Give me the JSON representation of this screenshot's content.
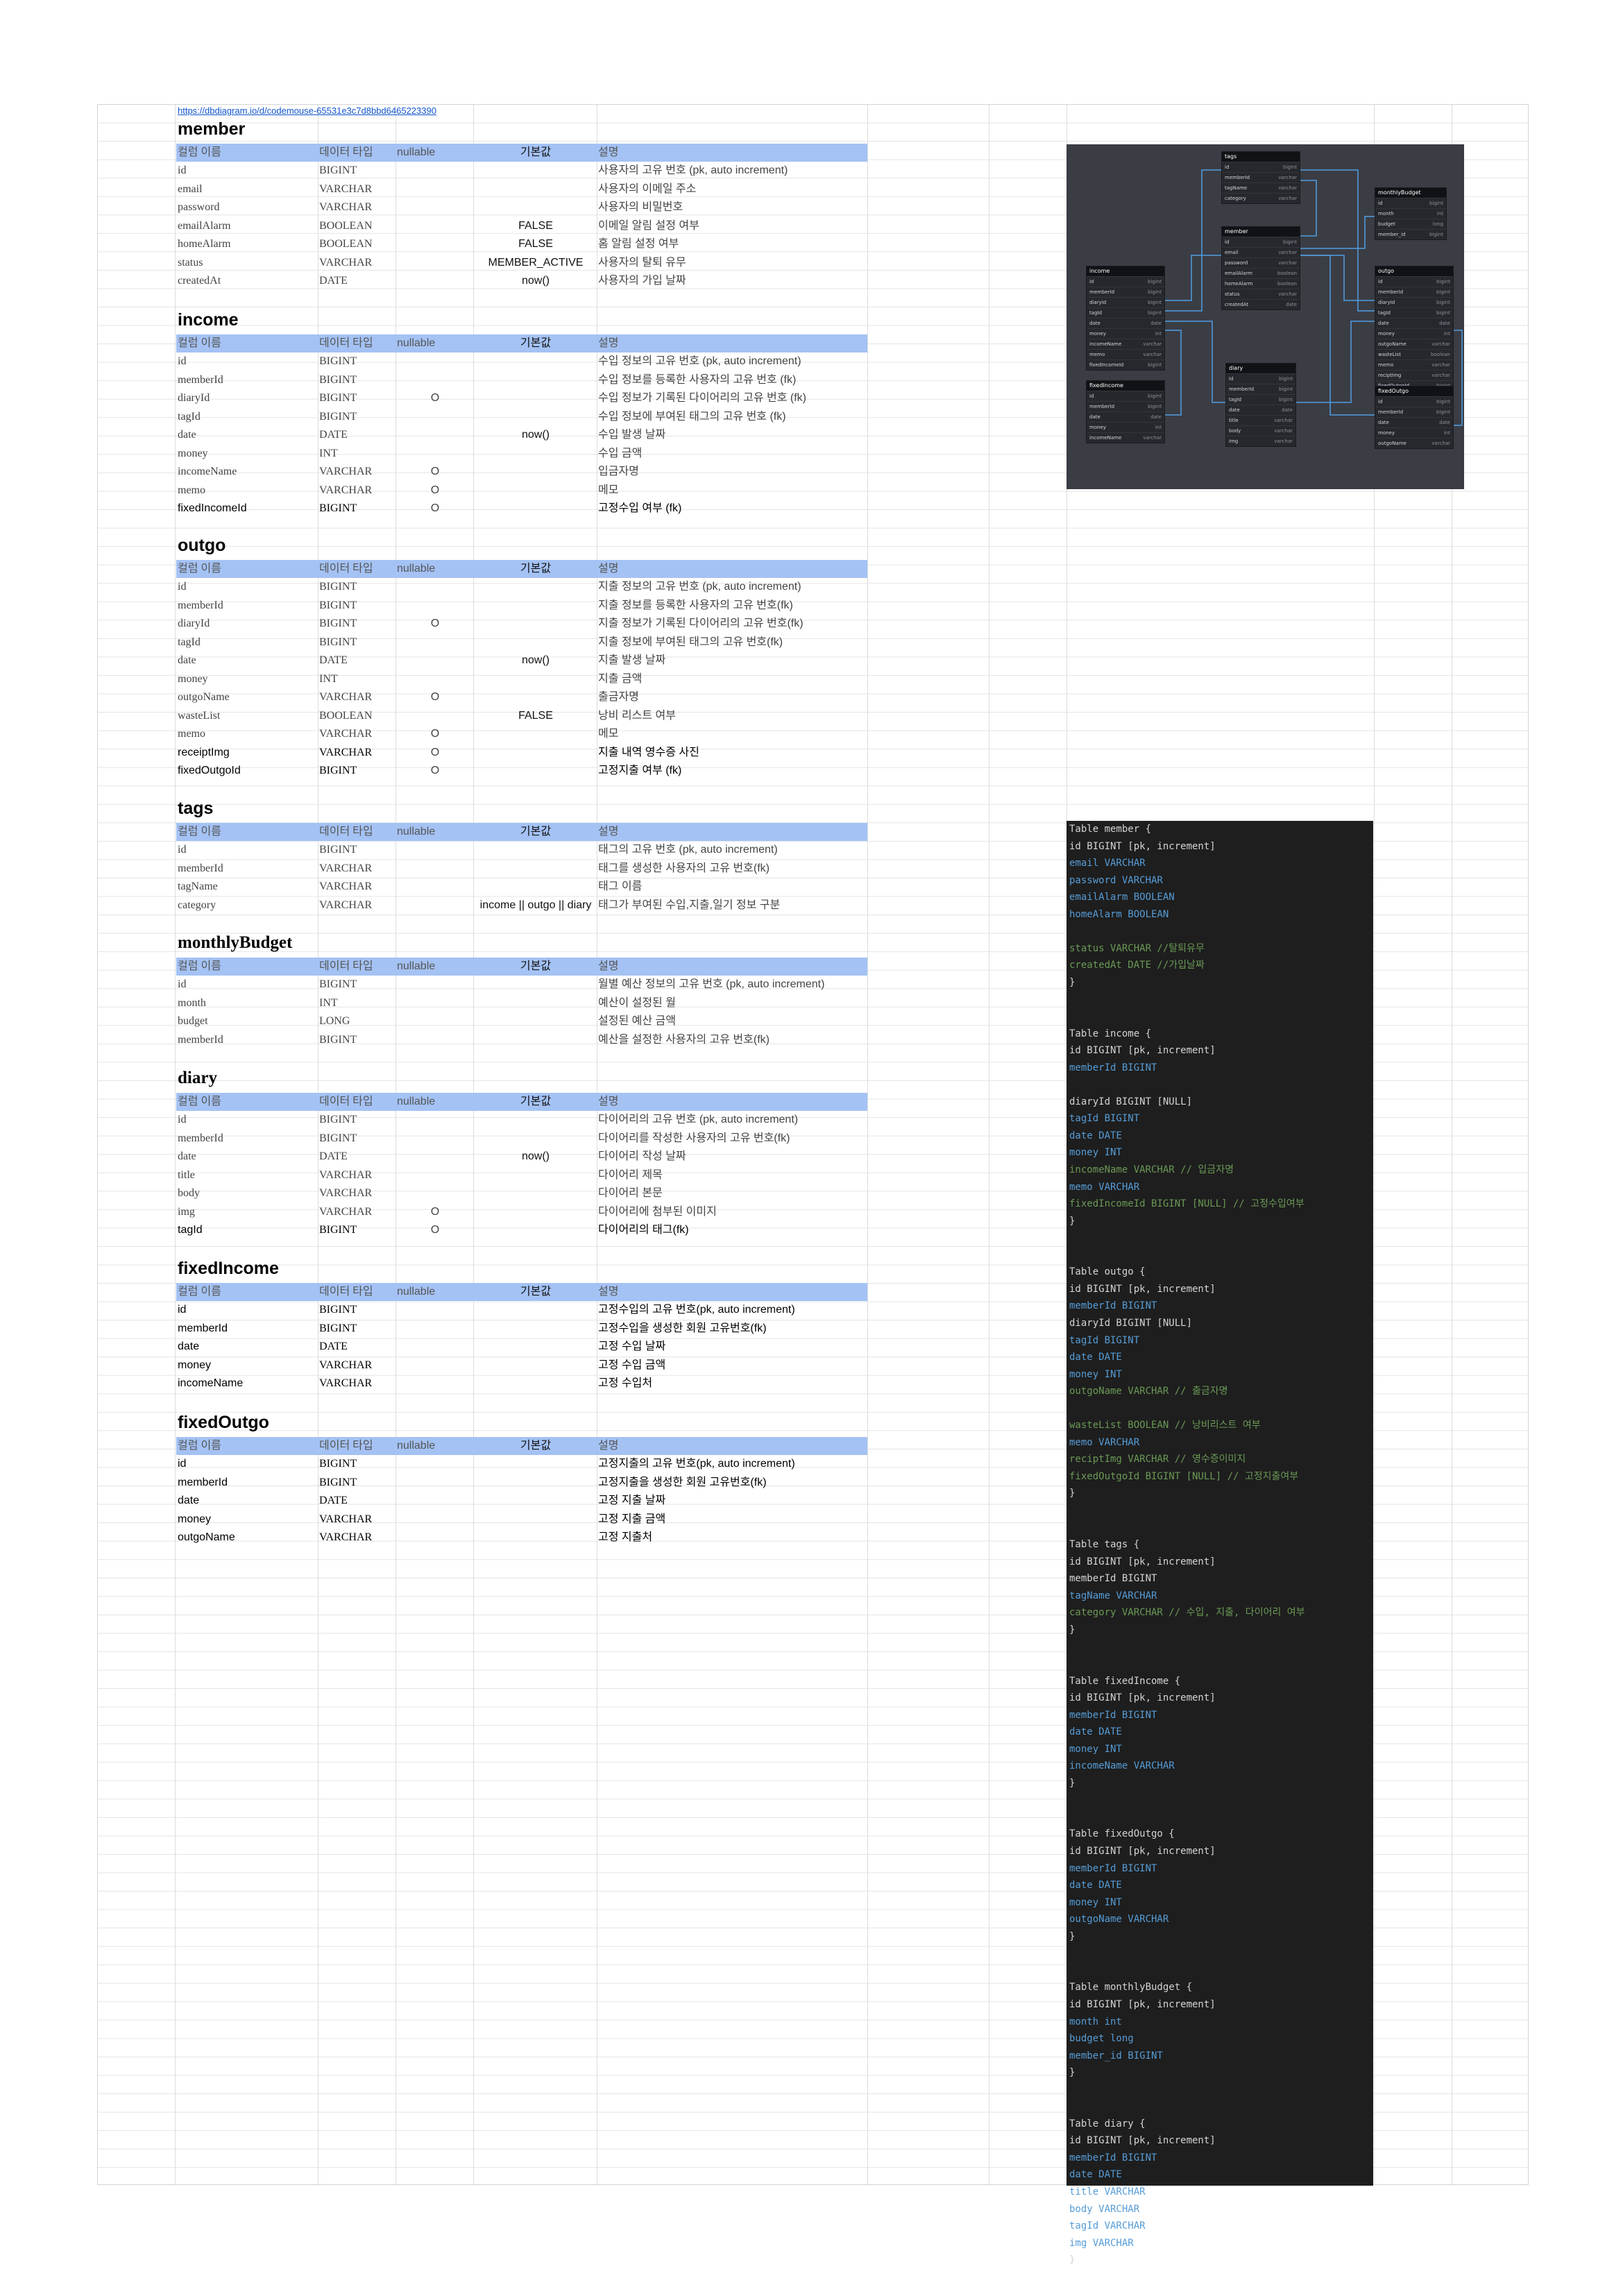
{
  "url": "https://dbdiagram.io/d/codemouse-65531e3c7d8bbd6465223390",
  "header_labels": [
    "컬럼 이름",
    "데이터 타입",
    "nullable",
    "기본값",
    "설명"
  ],
  "sections": [
    {
      "title": "member",
      "rows": [
        {
          "name": "id",
          "type": "BIGINT",
          "nullable": "",
          "default": "",
          "desc": "사용자의 고유 번호 (pk, auto increment)"
        },
        {
          "name": "email",
          "type": "VARCHAR",
          "nullable": "",
          "default": "",
          "desc": "사용자의 이메일 주소"
        },
        {
          "name": "password",
          "type": "VARCHAR",
          "nullable": "",
          "default": "",
          "desc": "사용자의 비밀번호"
        },
        {
          "name": "emailAlarm",
          "type": "BOOLEAN",
          "nullable": "",
          "default": "FALSE",
          "desc": "이메일 알림 설정 여부"
        },
        {
          "name": "homeAlarm",
          "type": "BOOLEAN",
          "nullable": "",
          "default": "FALSE",
          "desc": "홈 알림 설정 여부"
        },
        {
          "name": "status",
          "type": "VARCHAR",
          "nullable": "",
          "default": "MEMBER_ACTIVE",
          "desc": "사용자의 탈퇴 유무"
        },
        {
          "name": "createdAt",
          "type": "DATE",
          "nullable": "",
          "default": "now()",
          "desc": "사용자의 가입 날짜"
        }
      ]
    },
    {
      "title": "income",
      "rows": [
        {
          "name": "id",
          "type": "BIGINT",
          "nullable": "",
          "default": "",
          "desc": "수입 정보의 고유 번호 (pk, auto increment)"
        },
        {
          "name": "memberId",
          "type": "BIGINT",
          "nullable": "",
          "default": "",
          "desc": "수입 정보를 등록한 사용자의 고유 번호 (fk)"
        },
        {
          "name": "diaryId",
          "type": "BIGINT",
          "nullable": "O",
          "default": "",
          "desc": "수입 정보가 기록된 다이어리의 고유 번호 (fk)"
        },
        {
          "name": "tagId",
          "type": "BIGINT",
          "nullable": "",
          "default": "",
          "desc": "수입 정보에 부여된 태그의 고유 번호 (fk)"
        },
        {
          "name": "date",
          "type": "DATE",
          "nullable": "",
          "default": "now()",
          "desc": "수입 발생 날짜"
        },
        {
          "name": "money",
          "type": "INT",
          "nullable": "",
          "default": "",
          "desc": "수입 금액"
        },
        {
          "name": "incomeName",
          "type": "VARCHAR",
          "nullable": "O",
          "default": "",
          "desc": "입금자명"
        },
        {
          "name": "memo",
          "type": "VARCHAR",
          "nullable": "O",
          "default": "",
          "desc": "메모"
        },
        {
          "name": "fixedIncomeId",
          "type": "BIGINT",
          "nullable": "O",
          "default": "",
          "desc": "고정수입 여부 (fk)",
          "dark": true
        }
      ]
    },
    {
      "title": "outgo",
      "rows": [
        {
          "name": "id",
          "type": "BIGINT",
          "nullable": "",
          "default": "",
          "desc": "지출 정보의 고유 번호 (pk, auto increment)"
        },
        {
          "name": "memberId",
          "type": "BIGINT",
          "nullable": "",
          "default": "",
          "desc": "지출 정보를 등록한 사용자의 고유 번호(fk)"
        },
        {
          "name": "diaryId",
          "type": "BIGINT",
          "nullable": "O",
          "default": "",
          "desc": "지출 정보가 기록된 다이어리의 고유 번호(fk)"
        },
        {
          "name": "tagId",
          "type": "BIGINT",
          "nullable": "",
          "default": "",
          "desc": "지출 정보에 부여된 태그의 고유 번호(fk)"
        },
        {
          "name": "date",
          "type": "DATE",
          "nullable": "",
          "default": "now()",
          "desc": "지출 발생 날짜"
        },
        {
          "name": "money",
          "type": "INT",
          "nullable": "",
          "default": "",
          "desc": "지출 금액"
        },
        {
          "name": "outgoName",
          "type": "VARCHAR",
          "nullable": "O",
          "default": "",
          "desc": "출금자명"
        },
        {
          "name": "wasteList",
          "type": "BOOLEAN",
          "nullable": "",
          "default": "FALSE",
          "desc": "낭비 리스트 여부"
        },
        {
          "name": "memo",
          "type": "VARCHAR",
          "nullable": "O",
          "default": "",
          "desc": "메모"
        },
        {
          "name": "receiptImg",
          "type": "VARCHAR",
          "nullable": "O",
          "default": "",
          "desc": "지출 내역 영수증 사진",
          "dark": true
        },
        {
          "name": "fixedOutgoId",
          "type": "BIGINT",
          "nullable": "O",
          "default": "",
          "desc": "고정지출 여부 (fk)",
          "dark": true
        }
      ]
    },
    {
      "title": "tags",
      "rows": [
        {
          "name": "id",
          "type": "BIGINT",
          "nullable": "",
          "default": "",
          "desc": "태그의 고유 번호 (pk, auto increment)"
        },
        {
          "name": "memberId",
          "type": "VARCHAR",
          "nullable": "",
          "default": "",
          "desc": "태그를 생성한 사용자의 고유 번호(fk)"
        },
        {
          "name": "tagName",
          "type": "VARCHAR",
          "nullable": "",
          "default": "",
          "desc": "태그 이름"
        },
        {
          "name": "category",
          "type": "VARCHAR",
          "nullable": "",
          "default": "income || outgo || diary",
          "desc": "태그가 부여된 수입,지출,일기 정보 구분"
        }
      ]
    },
    {
      "title": "monthlyBudget",
      "serif": true,
      "rows": [
        {
          "name": "id",
          "type": "BIGINT",
          "nullable": "",
          "default": "",
          "desc": "월별 예산 정보의 고유 번호 (pk, auto increment)"
        },
        {
          "name": "month",
          "type": "INT",
          "nullable": "",
          "default": "",
          "desc": "예산이 설정된 월"
        },
        {
          "name": "budget",
          "type": "LONG",
          "nullable": "",
          "default": "",
          "desc": "설정된 예산 금액"
        },
        {
          "name": "memberId",
          "type": "BIGINT",
          "nullable": "",
          "default": "",
          "desc": "예산을 설정한 사용자의 고유 번호(fk)"
        }
      ]
    },
    {
      "title": "diary",
      "serif": true,
      "rows": [
        {
          "name": "id",
          "type": "BIGINT",
          "nullable": "",
          "default": "",
          "desc": "다이어리의 고유 번호 (pk, auto increment)"
        },
        {
          "name": "memberId",
          "type": "BIGINT",
          "nullable": "",
          "default": "",
          "desc": "다이어리를 작성한 사용자의 고유 번호(fk)"
        },
        {
          "name": "date",
          "type": "DATE",
          "nullable": "",
          "default": "now()",
          "desc": "다이어리 작성 날짜"
        },
        {
          "name": "title",
          "type": "VARCHAR",
          "nullable": "",
          "default": "",
          "desc": "다이어리 제목"
        },
        {
          "name": "body",
          "type": "VARCHAR",
          "nullable": "",
          "default": "",
          "desc": "다이어리 본문"
        },
        {
          "name": "img",
          "type": "VARCHAR",
          "nullable": "O",
          "default": "",
          "desc": "다이어리에 첨부된 이미지"
        },
        {
          "name": "tagId",
          "type": "BIGINT",
          "nullable": "O",
          "default": "",
          "desc": "다이어리의 태그(fk)",
          "dark": true
        }
      ]
    },
    {
      "title": "fixedIncome",
      "rows": [
        {
          "name": "id",
          "type": "BIGINT",
          "nullable": "",
          "default": "",
          "desc": "고정수입의 고유 번호(pk, auto increment)",
          "dark": true
        },
        {
          "name": "memberId",
          "type": "BIGINT",
          "nullable": "",
          "default": "",
          "desc": "고정수입을 생성한 회원 고유번호(fk)",
          "dark": true
        },
        {
          "name": "date",
          "type": "DATE",
          "nullable": "",
          "default": "",
          "desc": "고정 수입 날짜",
          "dark": true
        },
        {
          "name": "money",
          "type": "VARCHAR",
          "nullable": "",
          "default": "",
          "desc": "고정 수입 금액",
          "dark": true
        },
        {
          "name": "incomeName",
          "type": "VARCHAR",
          "nullable": "",
          "default": "",
          "desc": "고정 수입처",
          "dark": true
        }
      ]
    },
    {
      "title": "fixedOutgo",
      "rows": [
        {
          "name": "id",
          "type": "BIGINT",
          "nullable": "",
          "default": "",
          "desc": "고정지출의 고유 번호(pk, auto increment)",
          "dark": true
        },
        {
          "name": "memberId",
          "type": "BIGINT",
          "nullable": "",
          "default": "",
          "desc": "고정지출을 생성한 회원 고유번호(fk)",
          "dark": true
        },
        {
          "name": "date",
          "type": "DATE",
          "nullable": "",
          "default": "",
          "desc": "고정 지출 날짜",
          "dark": true
        },
        {
          "name": "money",
          "type": "VARCHAR",
          "nullable": "",
          "default": "",
          "desc": "고정 지출 금액",
          "dark": true
        },
        {
          "name": "outgoName",
          "type": "VARCHAR",
          "nullable": "",
          "default": "",
          "desc": "고정 지출처",
          "dark": true
        }
      ]
    }
  ],
  "er_diagram": {
    "tables": [
      {
        "name": "tags",
        "fields": [
          [
            "id",
            "bigint"
          ],
          [
            "memberId",
            "varchar"
          ],
          [
            "tagName",
            "varchar"
          ],
          [
            "category",
            "varchar"
          ]
        ]
      },
      {
        "name": "monthlyBudget",
        "fields": [
          [
            "id",
            "bigint"
          ],
          [
            "month",
            "int"
          ],
          [
            "budget",
            "long"
          ],
          [
            "member_id",
            "bigint"
          ]
        ]
      },
      {
        "name": "member",
        "fields": [
          [
            "id",
            "bigint"
          ],
          [
            "email",
            "varchar"
          ],
          [
            "password",
            "varchar"
          ],
          [
            "emailAlarm",
            "boolean"
          ],
          [
            "homeAlarm",
            "boolean"
          ],
          [
            "status",
            "varchar"
          ],
          [
            "createdAt",
            "date"
          ]
        ]
      },
      {
        "name": "income",
        "fields": [
          [
            "id",
            "bigint"
          ],
          [
            "memberId",
            "bigint"
          ],
          [
            "diaryId",
            "bigint"
          ],
          [
            "tagId",
            "bigint"
          ],
          [
            "date",
            "date"
          ],
          [
            "money",
            "int"
          ],
          [
            "incomeName",
            "varchar"
          ],
          [
            "memo",
            "varchar"
          ],
          [
            "fixedIncomeId",
            "bigint"
          ]
        ]
      },
      {
        "name": "outgo",
        "fields": [
          [
            "id",
            "bigint"
          ],
          [
            "memberId",
            "bigint"
          ],
          [
            "diaryId",
            "bigint"
          ],
          [
            "tagId",
            "bigint"
          ],
          [
            "date",
            "date"
          ],
          [
            "money",
            "int"
          ],
          [
            "outgoName",
            "varchar"
          ],
          [
            "wasteList",
            "boolean"
          ],
          [
            "memo",
            "varchar"
          ],
          [
            "reciptImg",
            "varchar"
          ],
          [
            "fixedOutgoId",
            "bigint"
          ]
        ]
      },
      {
        "name": "diary",
        "fields": [
          [
            "id",
            "bigint"
          ],
          [
            "memberId",
            "bigint"
          ],
          [
            "tagId",
            "bigint"
          ],
          [
            "date",
            "date"
          ],
          [
            "title",
            "varchar"
          ],
          [
            "body",
            "varchar"
          ],
          [
            "img",
            "varchar"
          ]
        ]
      },
      {
        "name": "fixedIncome",
        "fields": [
          [
            "id",
            "bigint"
          ],
          [
            "memberId",
            "bigint"
          ],
          [
            "date",
            "date"
          ],
          [
            "money",
            "int"
          ],
          [
            "incomeName",
            "varchar"
          ]
        ]
      },
      {
        "name": "fixedOutgo",
        "fields": [
          [
            "id",
            "bigint"
          ],
          [
            "memberId",
            "bigint"
          ],
          [
            "date",
            "date"
          ],
          [
            "money",
            "int"
          ],
          [
            "outgoName",
            "varchar"
          ]
        ]
      }
    ]
  },
  "code_lines": [
    [
      "w",
      "Table member {"
    ],
    [
      "w",
      "id BIGINT [pk, increment]"
    ],
    [
      "b",
      "email VARCHAR"
    ],
    [
      "b",
      "password VARCHAR"
    ],
    [
      "b",
      "emailAlarm BOOLEAN"
    ],
    [
      "b",
      "homeAlarm BOOLEAN"
    ],
    [
      "w",
      ""
    ],
    [
      "g",
      "status VARCHAR //탈퇴유무"
    ],
    [
      "g",
      "createdAt DATE //가입날짜"
    ],
    [
      "w",
      "}"
    ],
    [
      "w",
      ""
    ],
    [
      "w",
      ""
    ],
    [
      "w",
      "Table income {"
    ],
    [
      "w",
      "id BIGINT [pk, increment]"
    ],
    [
      "b",
      "memberId BIGINT"
    ],
    [
      "w",
      ""
    ],
    [
      "w",
      "diaryId BIGINT [NULL]"
    ],
    [
      "b",
      "tagId BIGINT"
    ],
    [
      "b",
      "date DATE"
    ],
    [
      "b",
      "money INT"
    ],
    [
      "g",
      "incomeName VARCHAR // 입금자명"
    ],
    [
      "b",
      "memo VARCHAR"
    ],
    [
      "g",
      "fixedIncomeId BIGINT [NULL] // 고정수입여부"
    ],
    [
      "w",
      "}"
    ],
    [
      "w",
      ""
    ],
    [
      "w",
      ""
    ],
    [
      "w",
      "Table outgo {"
    ],
    [
      "w",
      "id BIGINT [pk, increment]"
    ],
    [
      "b",
      "memberId BIGINT"
    ],
    [
      "w",
      "diaryId BIGINT [NULL]"
    ],
    [
      "b",
      "tagId BIGINT"
    ],
    [
      "b",
      "date DATE"
    ],
    [
      "b",
      "money INT"
    ],
    [
      "g",
      "outgoName VARCHAR // 출금자명"
    ],
    [
      "w",
      ""
    ],
    [
      "g",
      "wasteList BOOLEAN // 낭비리스트 여부"
    ],
    [
      "b",
      "memo VARCHAR"
    ],
    [
      "g",
      "reciptImg VARCHAR // 영수증이미지"
    ],
    [
      "g",
      "fixedOutgoId BIGINT [NULL] // 고정지출여부"
    ],
    [
      "w",
      "}"
    ],
    [
      "w",
      ""
    ],
    [
      "w",
      ""
    ],
    [
      "w",
      "Table tags {"
    ],
    [
      "w",
      "id BIGINT [pk, increment]"
    ],
    [
      "w",
      "memberId BIGINT"
    ],
    [
      "b",
      "tagName VARCHAR"
    ],
    [
      "g",
      "category VARCHAR // 수입, 지출, 다이어리 여부"
    ],
    [
      "w",
      "}"
    ],
    [
      "w",
      ""
    ],
    [
      "w",
      ""
    ],
    [
      "w",
      "Table fixedIncome {"
    ],
    [
      "w",
      "id BIGINT [pk, increment]"
    ],
    [
      "b",
      "memberId BIGINT"
    ],
    [
      "b",
      "date DATE"
    ],
    [
      "b",
      "money INT"
    ],
    [
      "b",
      "incomeName VARCHAR"
    ],
    [
      "w",
      "}"
    ],
    [
      "w",
      ""
    ],
    [
      "w",
      ""
    ],
    [
      "w",
      "Table fixedOutgo {"
    ],
    [
      "w",
      "id BIGINT [pk, increment]"
    ],
    [
      "b",
      "memberId BIGINT"
    ],
    [
      "b",
      "date DATE"
    ],
    [
      "b",
      "money INT"
    ],
    [
      "b",
      "outgoName VARCHAR"
    ],
    [
      "w",
      "}"
    ],
    [
      "w",
      ""
    ],
    [
      "w",
      ""
    ],
    [
      "w",
      "Table monthlyBudget {"
    ],
    [
      "w",
      "id BIGINT [pk, increment]"
    ],
    [
      "b",
      "month int"
    ],
    [
      "b",
      "budget long"
    ],
    [
      "b",
      "member_id BIGINT"
    ],
    [
      "w",
      "}"
    ],
    [
      "w",
      ""
    ],
    [
      "w",
      ""
    ],
    [
      "w",
      "Table diary {"
    ],
    [
      "w",
      "id BIGINT [pk, increment]"
    ],
    [
      "b",
      "memberId BIGINT"
    ],
    [
      "b",
      "date DATE"
    ],
    [
      "b",
      "title VARCHAR"
    ],
    [
      "b",
      "body VARCHAR"
    ],
    [
      "b",
      "tagId VARCHAR"
    ],
    [
      "b",
      "img VARCHAR"
    ],
    [
      "w",
      "}"
    ]
  ]
}
